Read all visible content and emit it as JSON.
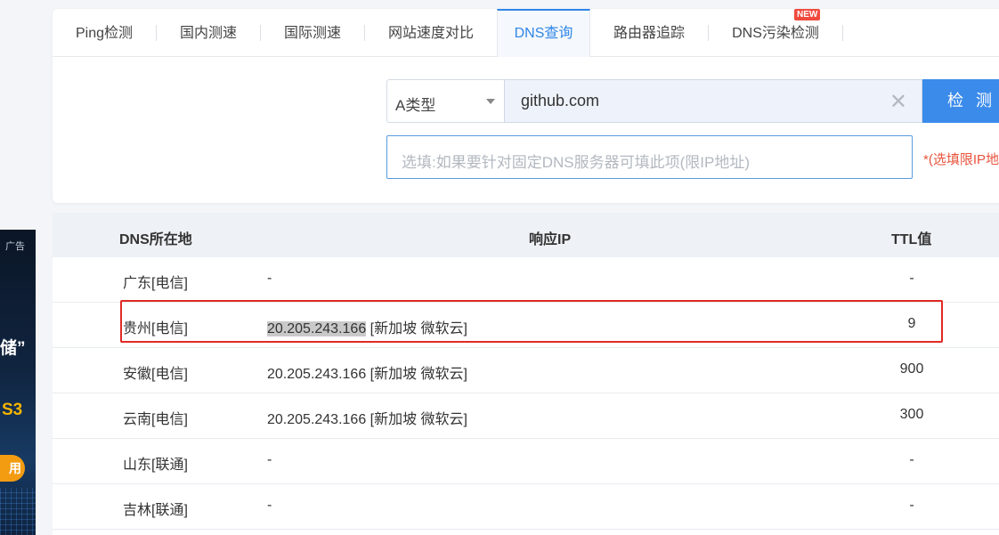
{
  "ad": {
    "label": "广告",
    "line1": "储”",
    "line2": "S3",
    "button": "用"
  },
  "tabs": [
    {
      "label": "Ping检测"
    },
    {
      "label": "国内测速"
    },
    {
      "label": "国际测速"
    },
    {
      "label": "网站速度对比"
    },
    {
      "label": "DNS查询",
      "active": true
    },
    {
      "label": "路由器追踪"
    },
    {
      "label": "DNS污染检测",
      "badge": "NEW"
    }
  ],
  "form": {
    "record_type": "A类型",
    "domain": "github.com",
    "submit_label": "检测",
    "dns_placeholder": "选填:如果要针对固定DNS服务器可填此项(限IP地址)",
    "dns_note": "*(选填限IP地"
  },
  "table": {
    "headers": {
      "location": "DNS所在地",
      "ip": "响应IP",
      "ttl": "TTL值"
    },
    "rows": [
      {
        "location": "广东[电信]",
        "ip": "-",
        "ip_extra": "",
        "ttl": "-"
      },
      {
        "location": "贵州[电信]",
        "ip": "20.205.243.166",
        "ip_extra": " [新加坡 微软云]",
        "ttl": "9",
        "highlighted": true
      },
      {
        "location": "安徽[电信]",
        "ip": "20.205.243.166",
        "ip_extra": " [新加坡 微软云]",
        "ttl": "900"
      },
      {
        "location": "云南[电信]",
        "ip": "20.205.243.166",
        "ip_extra": " [新加坡 微软云]",
        "ttl": "300"
      },
      {
        "location": "山东[联通]",
        "ip": "-",
        "ip_extra": "",
        "ttl": "-"
      },
      {
        "location": "吉林[联通]",
        "ip": "-",
        "ip_extra": "",
        "ttl": "-"
      }
    ]
  },
  "colors": {
    "accent": "#2f86e7",
    "highlight_box": "#e02a25",
    "new_badge": "#f04a3e"
  }
}
